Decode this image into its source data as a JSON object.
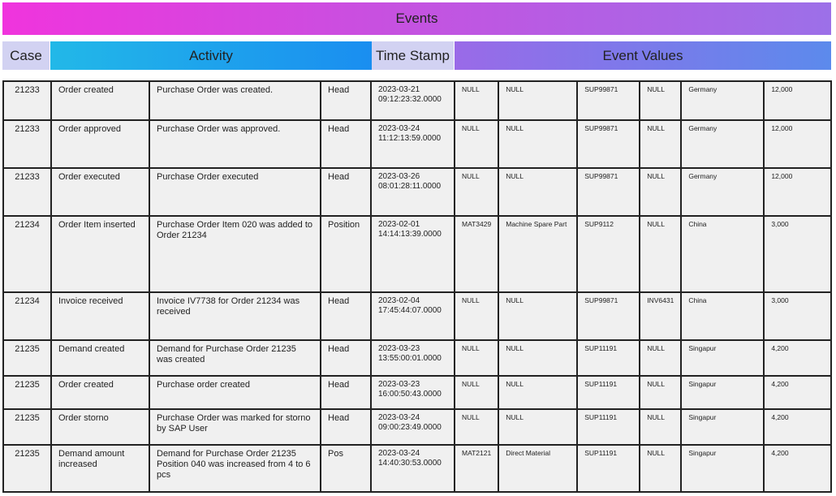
{
  "title": "Events",
  "headers": {
    "case": "Case",
    "activity": "Activity",
    "timestamp": "Time Stamp",
    "event_values": "Event Values"
  },
  "rows": [
    {
      "case": "21233",
      "activity": "Order created",
      "description": "Purchase Order was created.",
      "level": "Head",
      "timestamp": "2023-03-21 09:12:23:32.0000",
      "material": "NULL",
      "material_desc": "NULL",
      "supplier": "SUP99871",
      "invoice": "NULL",
      "country": "Germany",
      "amount": "12,000"
    },
    {
      "case": "21233",
      "activity": "Order approved",
      "description": "Purchase Order was approved.",
      "level": "Head",
      "timestamp": "2023-03-24 11:12:13:59.0000",
      "material": "NULL",
      "material_desc": "NULL",
      "supplier": "SUP99871",
      "invoice": "NULL",
      "country": "Germany",
      "amount": "12,000"
    },
    {
      "case": "21233",
      "activity": "Order executed",
      "description": "Purchase Order executed",
      "level": "Head",
      "timestamp": "2023-03-26 08:01:28:11.0000",
      "material": "NULL",
      "material_desc": "NULL",
      "supplier": "SUP99871",
      "invoice": "NULL",
      "country": "Germany",
      "amount": "12,000"
    },
    {
      "case": "21234",
      "activity": "Order Item inserted",
      "description": "Purchase Order Item 020 was added to Order 21234",
      "level": "Position",
      "timestamp": "2023-02-01 14:14:13:39.0000",
      "material": "MAT3429",
      "material_desc": "Machine Spare Part",
      "supplier": "SUP9112",
      "invoice": "NULL",
      "country": "China",
      "amount": "3,000"
    },
    {
      "case": "21234",
      "activity": "Invoice received",
      "description": "Invoice IV7738 for Order 21234 was received",
      "level": "Head",
      "timestamp": "2023-02-04 17:45:44:07.0000",
      "material": "NULL",
      "material_desc": "NULL",
      "supplier": "SUP99871",
      "invoice": "INV6431",
      "country": "China",
      "amount": "3,000"
    },
    {
      "case": "21235",
      "activity": "Demand created",
      "description": "Demand for Purchase Order 21235 was created",
      "level": "Head",
      "timestamp": "2023-03-23 13:55:00:01.0000",
      "material": "NULL",
      "material_desc": "NULL",
      "supplier": "SUP11191",
      "invoice": "NULL",
      "country": "Singapur",
      "amount": "4,200"
    },
    {
      "case": "21235",
      "activity": "Order created",
      "description": "Purchase order created",
      "level": "Head",
      "timestamp": "2023-03-23 16:00:50:43.0000",
      "material": "NULL",
      "material_desc": "NULL",
      "supplier": "SUP11191",
      "invoice": "NULL",
      "country": "Singapur",
      "amount": "4,200"
    },
    {
      "case": "21235",
      "activity": "Order storno",
      "description": "Purchase Order was marked for storno by SAP User",
      "level": "Head",
      "timestamp": "2023-03-24 09:00:23:49.0000",
      "material": "NULL",
      "material_desc": "NULL",
      "supplier": "SUP11191",
      "invoice": "NULL",
      "country": "Singapur",
      "amount": "4,200"
    },
    {
      "case": "21235",
      "activity": "Demand amount increased",
      "description": "Demand for Purchase Order 21235 Position 040 was increased from 4 to 6 pcs",
      "level": "Pos",
      "timestamp": "2023-03-24 14:40:30:53.0000",
      "material": "MAT2121",
      "material_desc": "Direct Material",
      "supplier": "SUP11191",
      "invoice": "NULL",
      "country": "Singapur",
      "amount": "4,200"
    }
  ]
}
